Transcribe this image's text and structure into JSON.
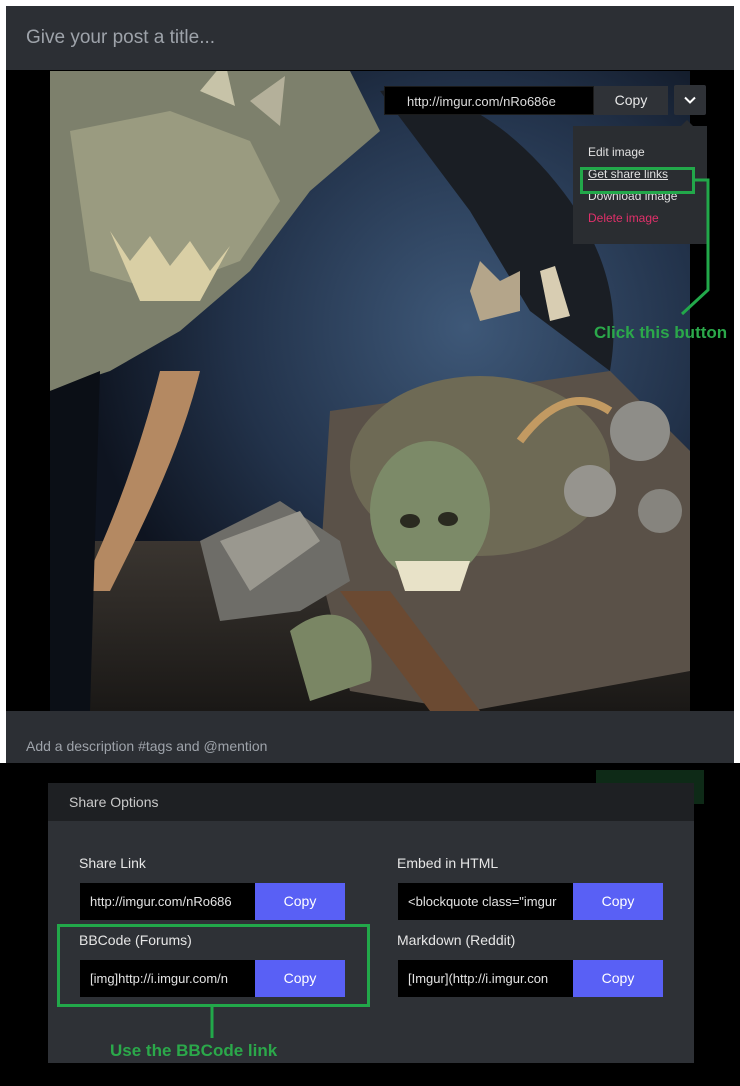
{
  "post": {
    "title_placeholder": "Give your post a title...",
    "description_placeholder": "Add a description #tags and @mention"
  },
  "image_toolbar": {
    "url": "http://imgur.com/nRo686e",
    "copy_label": "Copy",
    "dropdown_icon": "chevron-down-icon"
  },
  "image_menu": {
    "items": [
      {
        "label": "Edit image"
      },
      {
        "label": "Get share links"
      },
      {
        "label": "Download image"
      },
      {
        "label": "Delete image"
      }
    ]
  },
  "annotations": {
    "click_this_button": "Click this button",
    "use_bbcode_link": "Use the BBCode link"
  },
  "share_modal": {
    "title": "Share Options",
    "fields": [
      {
        "label": "Share Link",
        "value": "http://imgur.com/nRo686",
        "copy_label": "Copy"
      },
      {
        "label": "Embed in HTML",
        "value": "<blockquote class=\"imgur",
        "copy_label": "Copy"
      },
      {
        "label": "BBCode (Forums)",
        "value": "[img]http://i.imgur.com/n",
        "copy_label": "Copy"
      },
      {
        "label": "Markdown (Reddit)",
        "value": "[Imgur](http://i.imgur.con",
        "copy_label": "Copy"
      }
    ]
  },
  "colors": {
    "accent_copy": "#5960f5",
    "annotation_green": "#2ba84a",
    "delete_red": "#e0306a",
    "panel_dark": "#2c2f34"
  }
}
